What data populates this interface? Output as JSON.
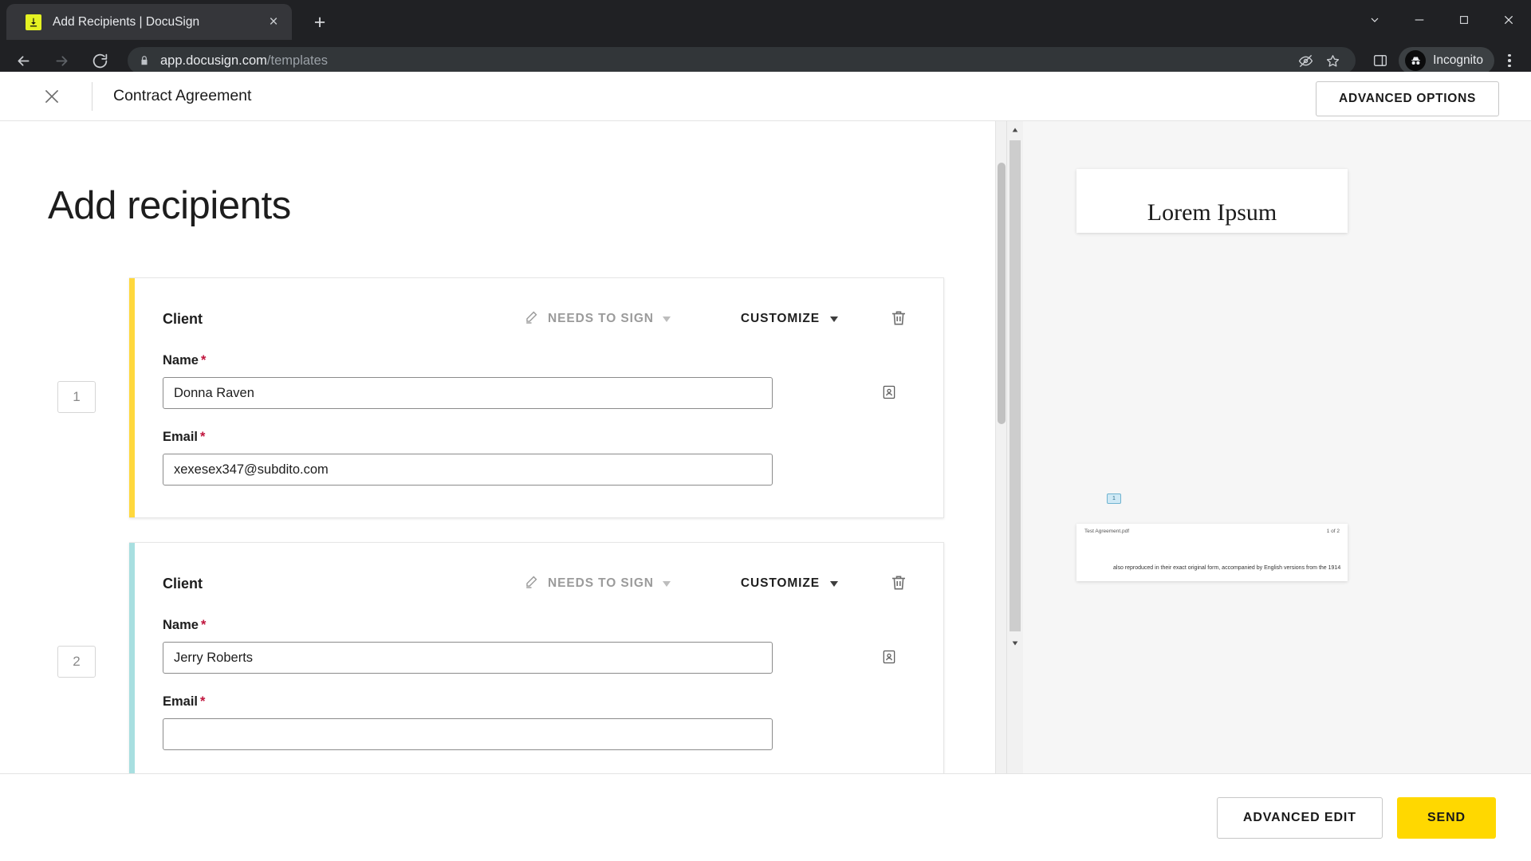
{
  "browser": {
    "tab": {
      "title": "Add Recipients | DocuSign",
      "favicon": "download-icon",
      "close": "×"
    },
    "new_tab_label": "+",
    "window_controls": [
      "minimize-all-icon",
      "minimize-icon",
      "maximize-icon",
      "close-icon"
    ],
    "nav": {
      "back": "back-icon",
      "forward": "forward-icon",
      "reload": "reload-icon"
    },
    "omnibox": {
      "lock": "lock-icon",
      "url_domain": "app.docusign.com",
      "url_path": "/templates",
      "third_party_cookie_icon": "eye-slash-icon",
      "bookmark_icon": "star-icon"
    },
    "side_panel_icon": "side-panel-icon",
    "incognito": {
      "label": "Incognito",
      "avatar": "incognito-avatar-icon"
    },
    "menu_icon": "three-dot-menu-icon"
  },
  "app": {
    "header": {
      "close_icon": "close-icon",
      "document_title": "Contract Agreement",
      "advanced_options_label": "ADVANCED OPTIONS"
    },
    "page_title": "Add recipients",
    "recipients": [
      {
        "index": "1",
        "accent_color": "#ffd83d",
        "role": "Client",
        "action_label": "NEEDS TO SIGN",
        "action_icon": "pen-icon",
        "customize_label": "CUSTOMIZE",
        "delete_icon": "trash-icon",
        "name_label": "Name",
        "name_value": "Donna Raven",
        "name_icon": "contacts-icon",
        "email_label": "Email",
        "email_value": "xexesex347@subdito.com",
        "required_mark": "*"
      },
      {
        "index": "2",
        "accent_color": "#a8dfe0",
        "role": "Client",
        "action_label": "NEEDS TO SIGN",
        "action_icon": "pen-icon",
        "customize_label": "CUSTOMIZE",
        "delete_icon": "trash-icon",
        "name_label": "Name",
        "name_value": "Jerry Roberts",
        "name_icon": "contacts-icon",
        "email_label": "Email",
        "email_value": "",
        "required_mark": "*"
      }
    ],
    "preview": {
      "doc_heading": "Lorem Ipsum",
      "tag_label": "1",
      "page_file_name": "Test Agreement.pdf",
      "page_count": "1 of 2",
      "body_text": "also reproduced in their exact original form, accompanied by English versions from the 1914"
    },
    "footer": {
      "advanced_edit_label": "ADVANCED EDIT",
      "send_label": "SEND",
      "send_color": "#ffd800"
    }
  }
}
